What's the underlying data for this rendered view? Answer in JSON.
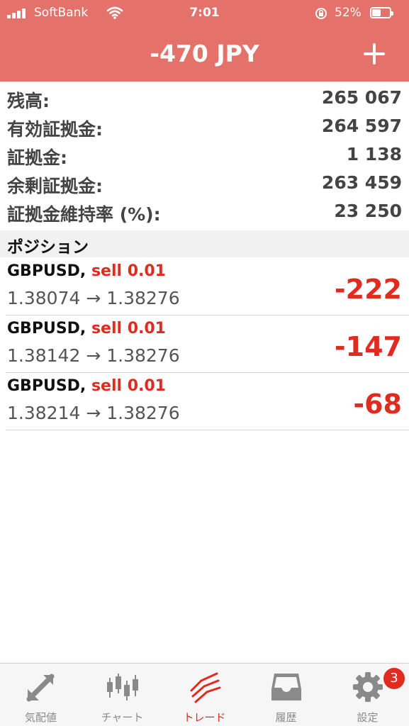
{
  "status_bar": {
    "carrier": "SoftBank",
    "time": "7:01",
    "battery_percent": "52%",
    "battery_level": 0.52
  },
  "header": {
    "title": "-470 JPY",
    "add_icon": "plus-icon"
  },
  "account": {
    "rows": [
      {
        "label": "残高:",
        "value": "265 067"
      },
      {
        "label": "有効証拠金:",
        "value": "264 597"
      },
      {
        "label": "証拠金:",
        "value": "1 138"
      },
      {
        "label": "余剰証拠金:",
        "value": "263 459"
      },
      {
        "label": "証拠金維持率 (%):",
        "value": "23 250"
      }
    ]
  },
  "positions": {
    "header": "ポジション",
    "items": [
      {
        "symbol": "GBPUSD,",
        "side": "sell 0.01",
        "prices": "1.38074 → 1.38276",
        "profit": "-222"
      },
      {
        "symbol": "GBPUSD,",
        "side": "sell 0.01",
        "prices": "1.38142 → 1.38276",
        "profit": "-147"
      },
      {
        "symbol": "GBPUSD,",
        "side": "sell 0.01",
        "prices": "1.38214 → 1.38276",
        "profit": "-68"
      }
    ]
  },
  "tabbar": {
    "tabs": [
      {
        "label": "気配値",
        "icon": "quotes-arrows-icon"
      },
      {
        "label": "チャート",
        "icon": "candlestick-chart-icon"
      },
      {
        "label": "トレード",
        "icon": "trade-chart-icon",
        "active": true
      },
      {
        "label": "履歴",
        "icon": "inbox-history-icon"
      },
      {
        "label": "設定",
        "icon": "gear-icon",
        "badge": "3"
      }
    ]
  },
  "colors": {
    "header_bg": "#e4716a",
    "accent_red": "#e02b20",
    "tab_inactive": "#8a8a8a"
  }
}
